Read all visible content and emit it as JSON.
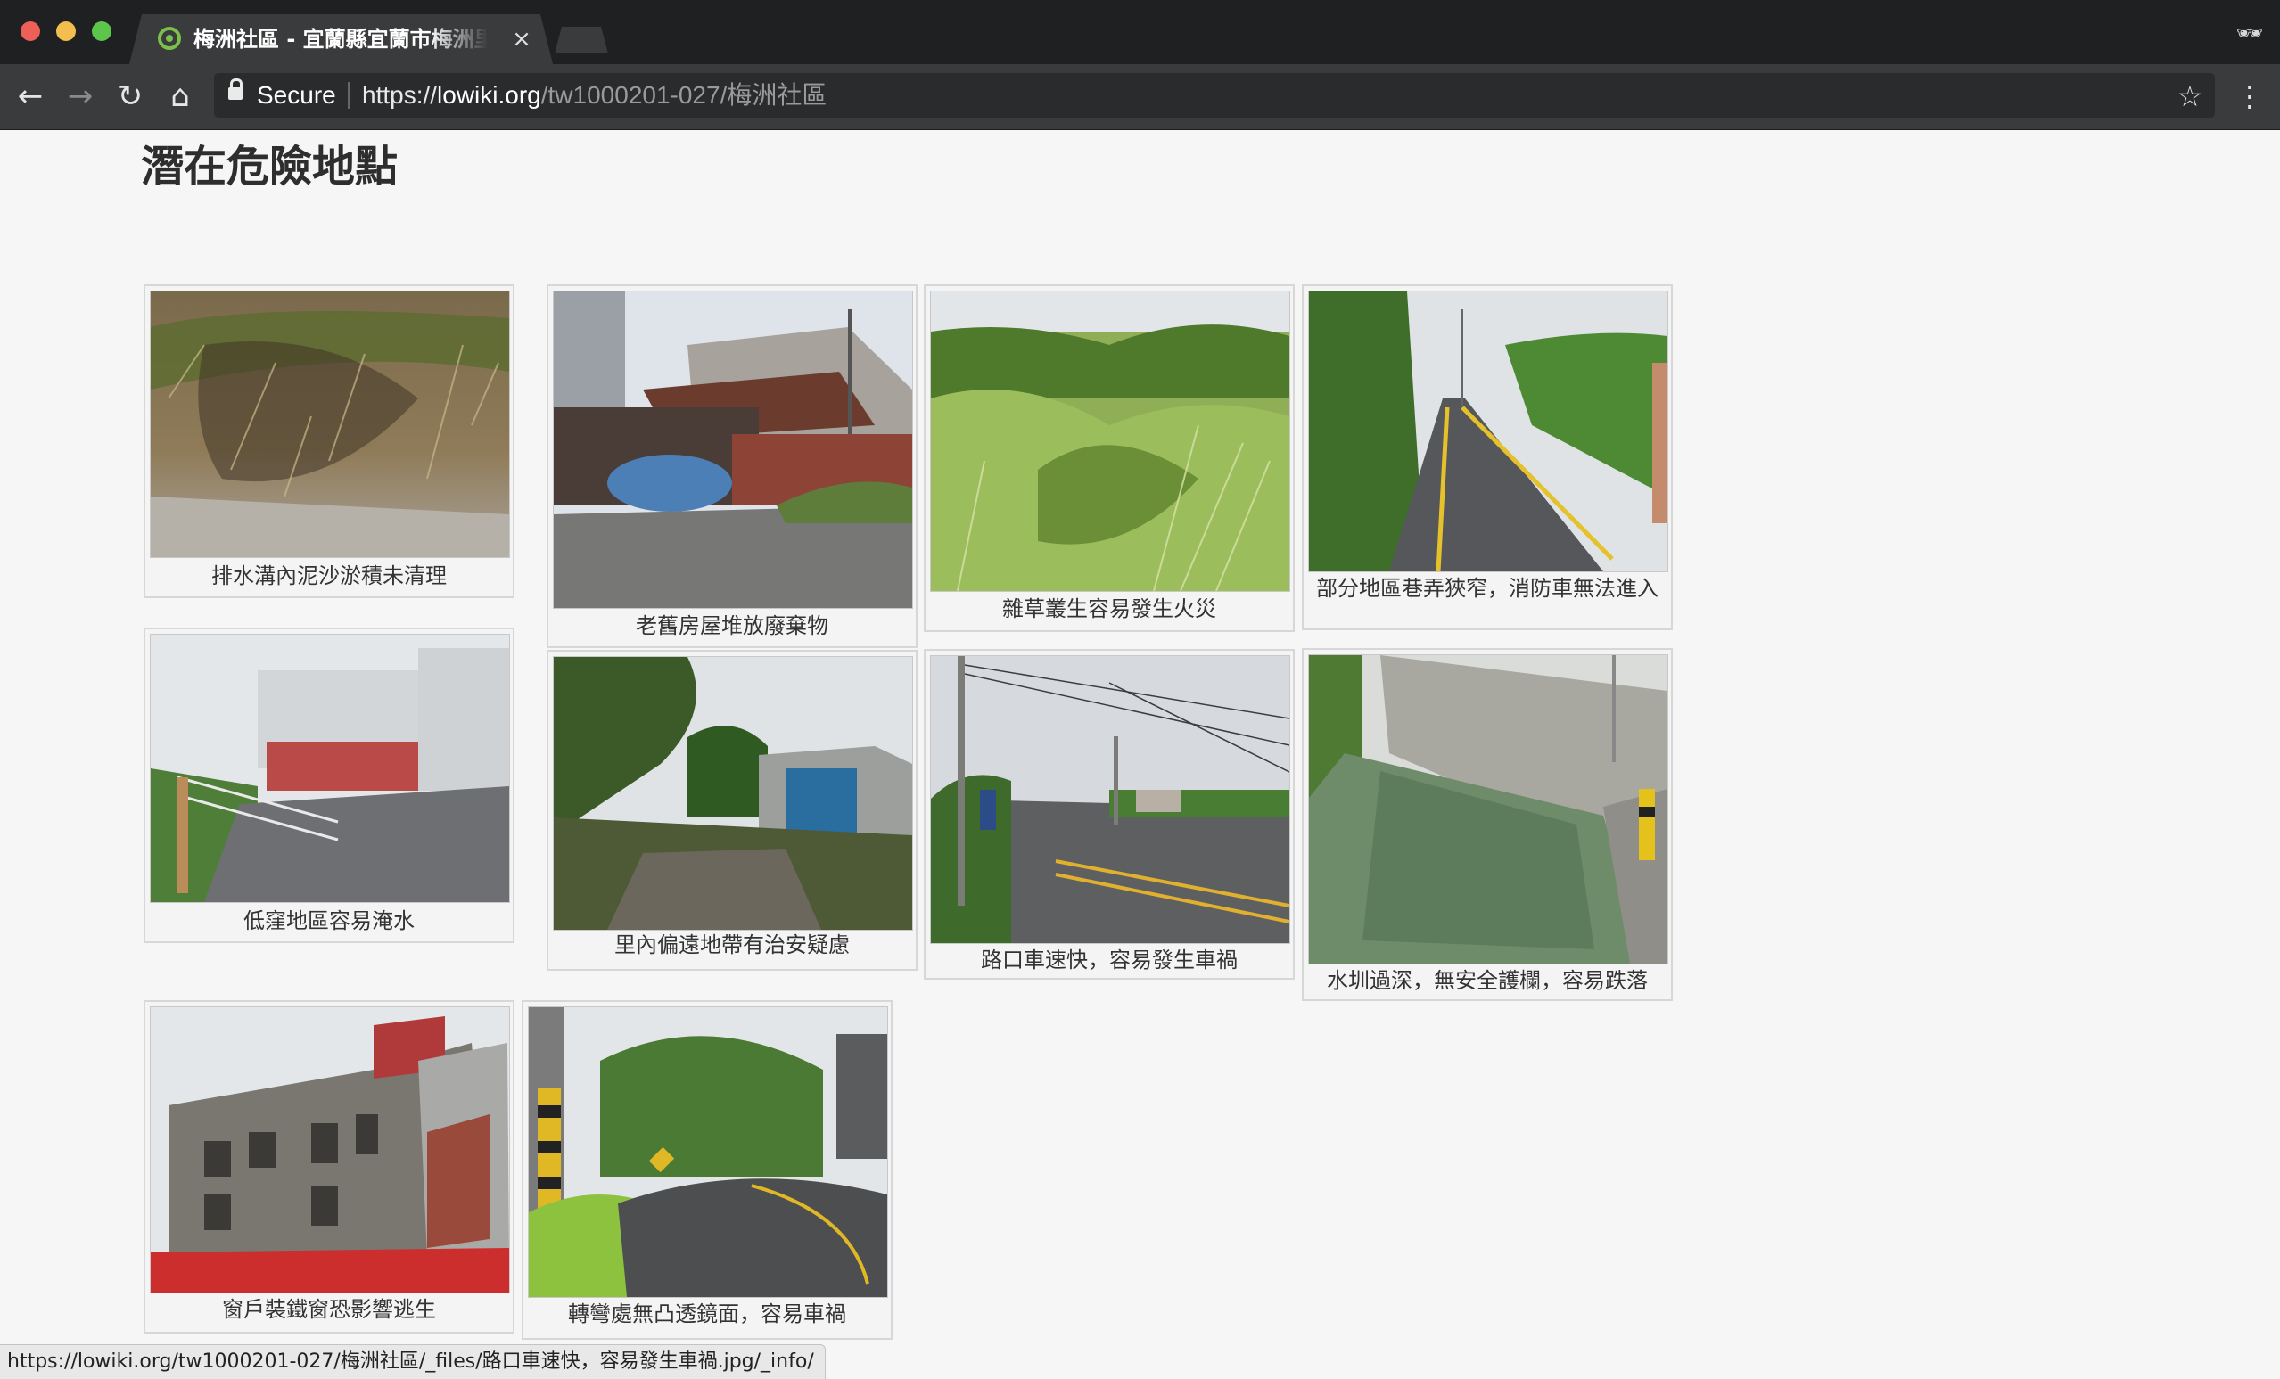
{
  "browser": {
    "tab_title": "梅洲社區 - 宜蘭縣宜蘭市梅洲里",
    "tab_close": "×",
    "secure_label": "Secure",
    "url_scheme": "https://",
    "url_host": "lowiki.org",
    "url_path": "/tw1000201-027/梅洲社區",
    "icons": {
      "back": "←",
      "forward": "→",
      "reload": "↻",
      "home": "⌂",
      "star": "☆",
      "menu": "⋮",
      "incognito": "🕶"
    },
    "status_url": "https://lowiki.org/tw1000201-027/梅洲社區/_files/路口車速快，容易發生車禍.jpg/_info/"
  },
  "page": {
    "title": "潛在危險地點",
    "gallery": [
      {
        "caption": "排水溝內泥沙淤積未清理",
        "photo": "drainage-ditch-silt"
      },
      {
        "caption": "老舊房屋堆放廢棄物",
        "photo": "old-house-waste"
      },
      {
        "caption": "雜草叢生容易發生火災",
        "photo": "overgrown-weeds"
      },
      {
        "caption": "部分地區巷弄狹窄，消防車無法進入",
        "photo": "narrow-lane"
      },
      {
        "caption": "低窪地區容易淹水",
        "photo": "low-lying-road"
      },
      {
        "caption": "里內偏遠地帶有治安疑慮",
        "photo": "remote-shed"
      },
      {
        "caption": "路口車速快，容易發生車禍",
        "photo": "fast-intersection"
      },
      {
        "caption": "水圳過深，無安全護欄，容易跌落",
        "photo": "deep-canal"
      },
      {
        "caption": "窗戶裝鐵窗恐影響逃生",
        "photo": "barred-windows-building"
      },
      {
        "caption": "轉彎處無凸透鏡面，容易車禍",
        "photo": "curve-no-mirror"
      }
    ]
  },
  "colors": {
    "chrome_dark": "#1f2021",
    "chrome_toolbar": "#3a3b3d",
    "page_background": "#f6f6f6",
    "card_border": "#d7d7d7"
  }
}
